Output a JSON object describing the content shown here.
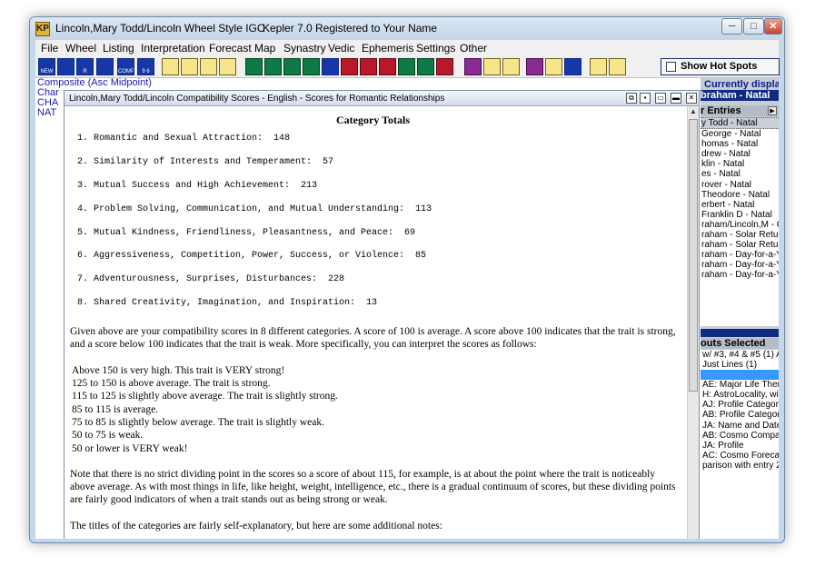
{
  "window": {
    "title_main": "Lincoln,Mary Todd/Lincoln Wheel Style IGC",
    "title_app": "Kepler 7.0",
    "title_reg": "Registered to Your Name",
    "app_icon": "KP",
    "min_glyph": "─",
    "max_glyph": "□",
    "close_glyph": "✕"
  },
  "menu": [
    "File",
    "Wheel",
    "Listing",
    "Interpretation",
    "Forecast",
    "Map",
    "Synastry",
    "Vedic",
    "Ephemeris",
    "Settings",
    "Other"
  ],
  "toolbar": {
    "buttons": [
      "NEW",
      "",
      "R",
      "",
      "COMP",
      "9 6",
      "",
      "",
      "",
      "",
      "",
      "",
      "",
      "",
      "1 2",
      "",
      "",
      "",
      "",
      "",
      "",
      "",
      "",
      "",
      "",
      "",
      "",
      "",
      "",
      "",
      "",
      "",
      ""
    ],
    "hot_spots_label": "Show Hot Spots"
  },
  "chart_lines": [
    "Composite (Asc Midpoint)",
    "Char",
    "CHA",
    "NAT"
  ],
  "right_panel": {
    "current_label": "Currently displayed entry:",
    "current_entry": "braham - Natal",
    "entries_header": "r Entries",
    "entries": [
      "y Todd - Natal",
      "George - Natal",
      "homas - Natal",
      "drew - Natal",
      "klin - Natal",
      "es - Natal",
      "rover - Natal",
      "Theodore - Natal",
      "erbert - Natal",
      "Franklin D - Natal",
      "raham/Lincoln,M - Co",
      "raham - Solar Return",
      "raham - Solar Return",
      "raham - Day-for-a-Yea",
      "raham - Day-for-a-Yea",
      "raham - Day-for-a-Yea"
    ],
    "outs_label": "outs Selected",
    "outs": [
      "w/ #3, #4 & #5 (1) AA",
      "Just Lines (1)",
      "",
      "",
      "",
      "",
      "",
      "",
      "AE: Major Life Themes",
      "H: AstroLocality, with",
      "AJ: Profile Category S",
      "AB: Profile Category S",
      "JA: Name and Date",
      "AB: Cosmo Compatib",
      "JA: Profile",
      "AC: Cosmo Forecast",
      "parison  with entry 2"
    ]
  },
  "report": {
    "title": "Lincoln,Mary Todd/Lincoln Compatibility Scores - English - Scores for Romantic Relationships",
    "heading": "Category Totals",
    "categories": [
      "1. Romantic and Sexual Attraction:  148",
      "2. Similarity of Interests and Temperament:  57",
      "3. Mutual Success and High Achievement:  213",
      "4. Problem Solving, Communication, and Mutual Understanding:  113",
      "5. Mutual Kindness, Friendliness, Pleasantness, and Peace:  69",
      "6. Aggressiveness, Competition, Power, Success, or Violence:  85",
      "7. Adventurousness, Surprises, Disturbances:  228",
      "8. Shared Creativity, Imagination, and Inspiration:  13"
    ],
    "para1": "Given above are your compatibility scores in 8 different categories. A score of 100 is average. A score above 100 indicates that the trait is strong, and a score below 100 indicates that the trait is weak. More specifically, you can interpret the scores as follows:",
    "scale": [
      "Above 150 is very high. This trait is VERY strong!",
      "125 to 150 is above average. The trait is strong.",
      "115 to 125 is slightly above average. The trait is slightly strong.",
      "85 to 115 is average.",
      "75 to 85 is slightly below average. The trait is slightly weak.",
      "50 to 75 is weak.",
      "50 or lower is VERY weak!"
    ],
    "para2": "Note that there is no strict dividing point in the scores so a score of about 115, for example, is at about the point where the trait is noticeably above average. As with most things in life, like height, weight, intelligence, etc., there is a gradual continuum of scores, but these dividing points are fairly good indicators of when a trait stands out as being strong or weak.",
    "para3": "The titles of the categories are fairly self-explanatory, but here are some additional notes:"
  }
}
